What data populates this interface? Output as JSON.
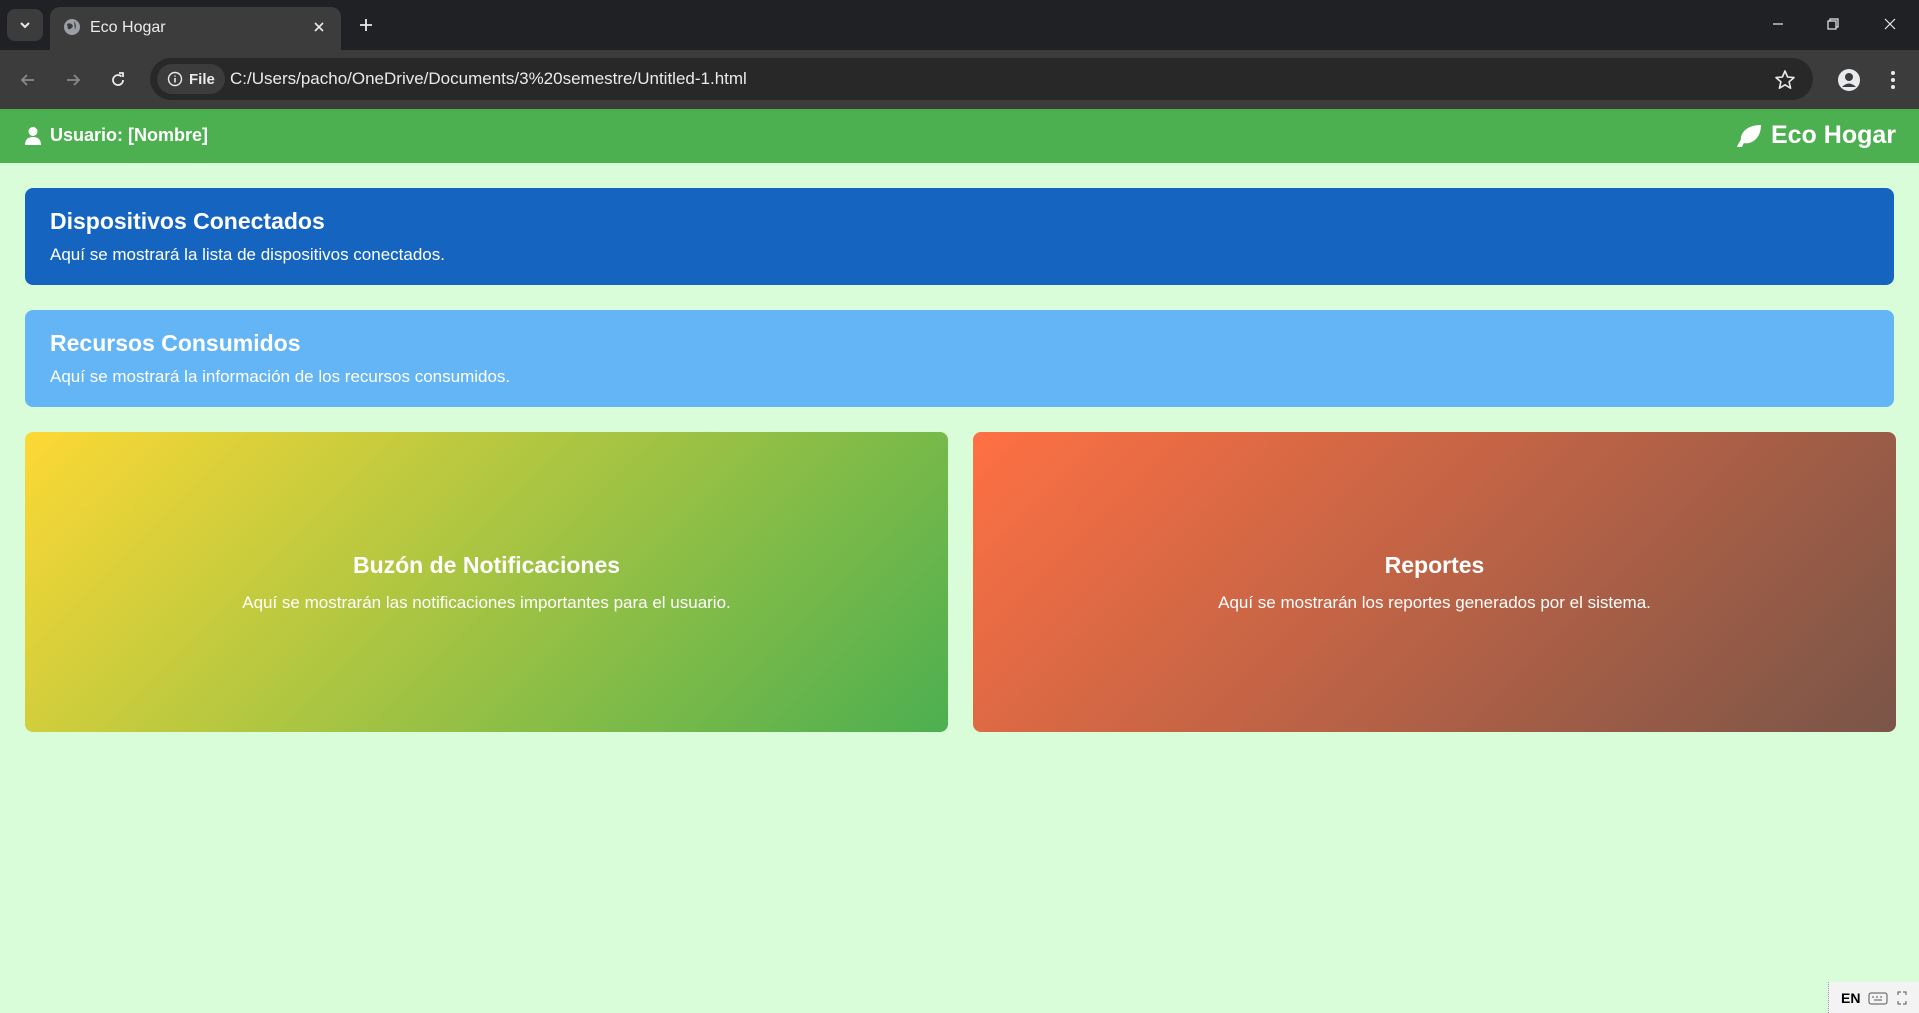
{
  "browser": {
    "tab_title": "Eco Hogar",
    "chip_label": "File",
    "url": "C:/Users/pacho/OneDrive/Documents/3%20semestre/Untitled-1.html"
  },
  "header": {
    "user_label": "Usuario: [Nombre]",
    "brand": "Eco Hogar"
  },
  "cards": {
    "devices": {
      "title": "Dispositivos Conectados",
      "text": "Aquí se mostrará la lista de dispositivos conectados.",
      "color": "#1565c0"
    },
    "resources": {
      "title": "Recursos Consumidos",
      "text": "Aquí se mostrará la información de los recursos consumidos.",
      "color": "#64b5f6"
    },
    "notifications": {
      "title": "Buzón de Notificaciones",
      "text": "Aquí se mostrarán las notificaciones importantes para el usuario.",
      "gradient": [
        "#fdd835",
        "#4caf50"
      ]
    },
    "reports": {
      "title": "Reportes",
      "text": "Aquí se mostrarán los reportes generados por el sistema.",
      "gradient": [
        "#ff7043",
        "#795548"
      ]
    }
  },
  "colors": {
    "header": "#4caf50",
    "background": "#d8fdd8"
  },
  "taskbar": {
    "language": "EN"
  }
}
